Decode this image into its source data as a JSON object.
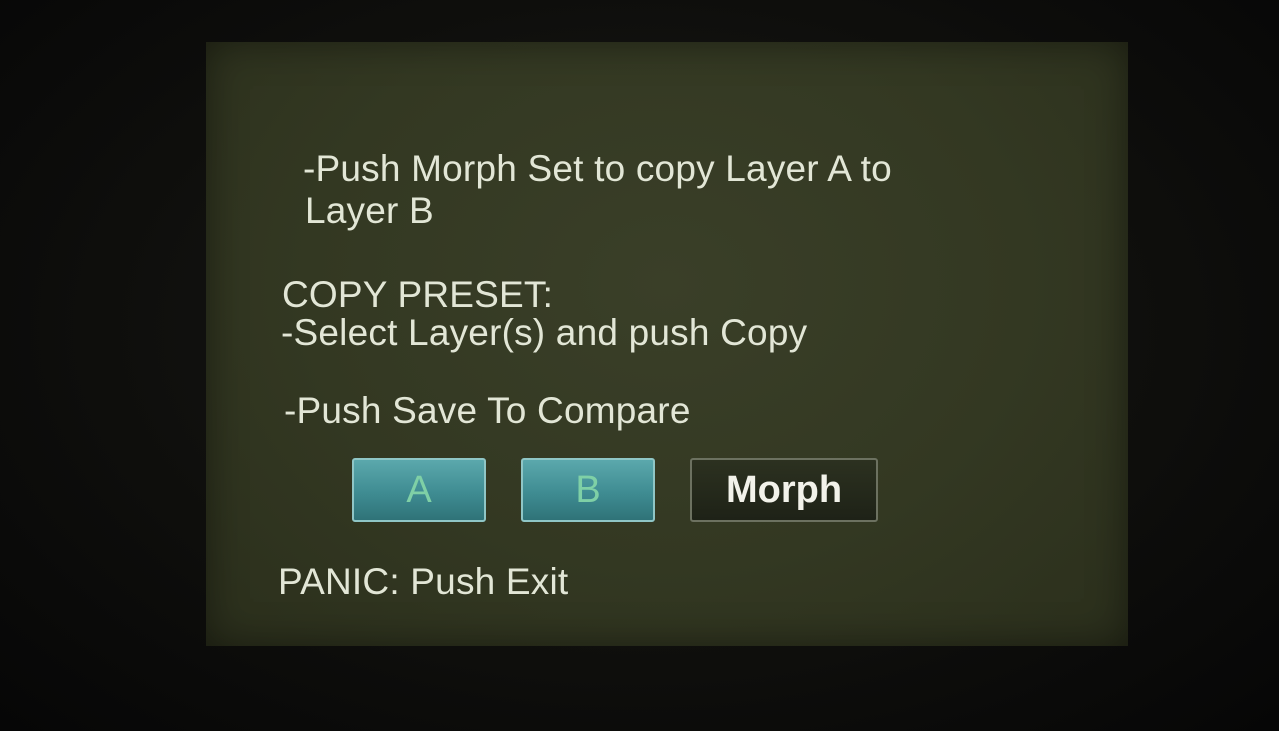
{
  "instructions": {
    "line1": "-Push Morph Set to copy Layer A to",
    "line2": "Layer B",
    "line3": "COPY PRESET:",
    "line4": "-Select Layer(s) and push Copy",
    "line5": "-Push Save To Compare"
  },
  "buttons": {
    "a_label": "A",
    "b_label": "B",
    "morph_label": "Morph"
  },
  "footer": {
    "panic": "PANIC: Push Exit"
  },
  "colors": {
    "screen_bg": "#363b25",
    "text": "#e2e6d6",
    "layer_button": "#4a9aa0",
    "layer_button_text": "#7fd0a6",
    "morph_button": "#252a1b"
  }
}
